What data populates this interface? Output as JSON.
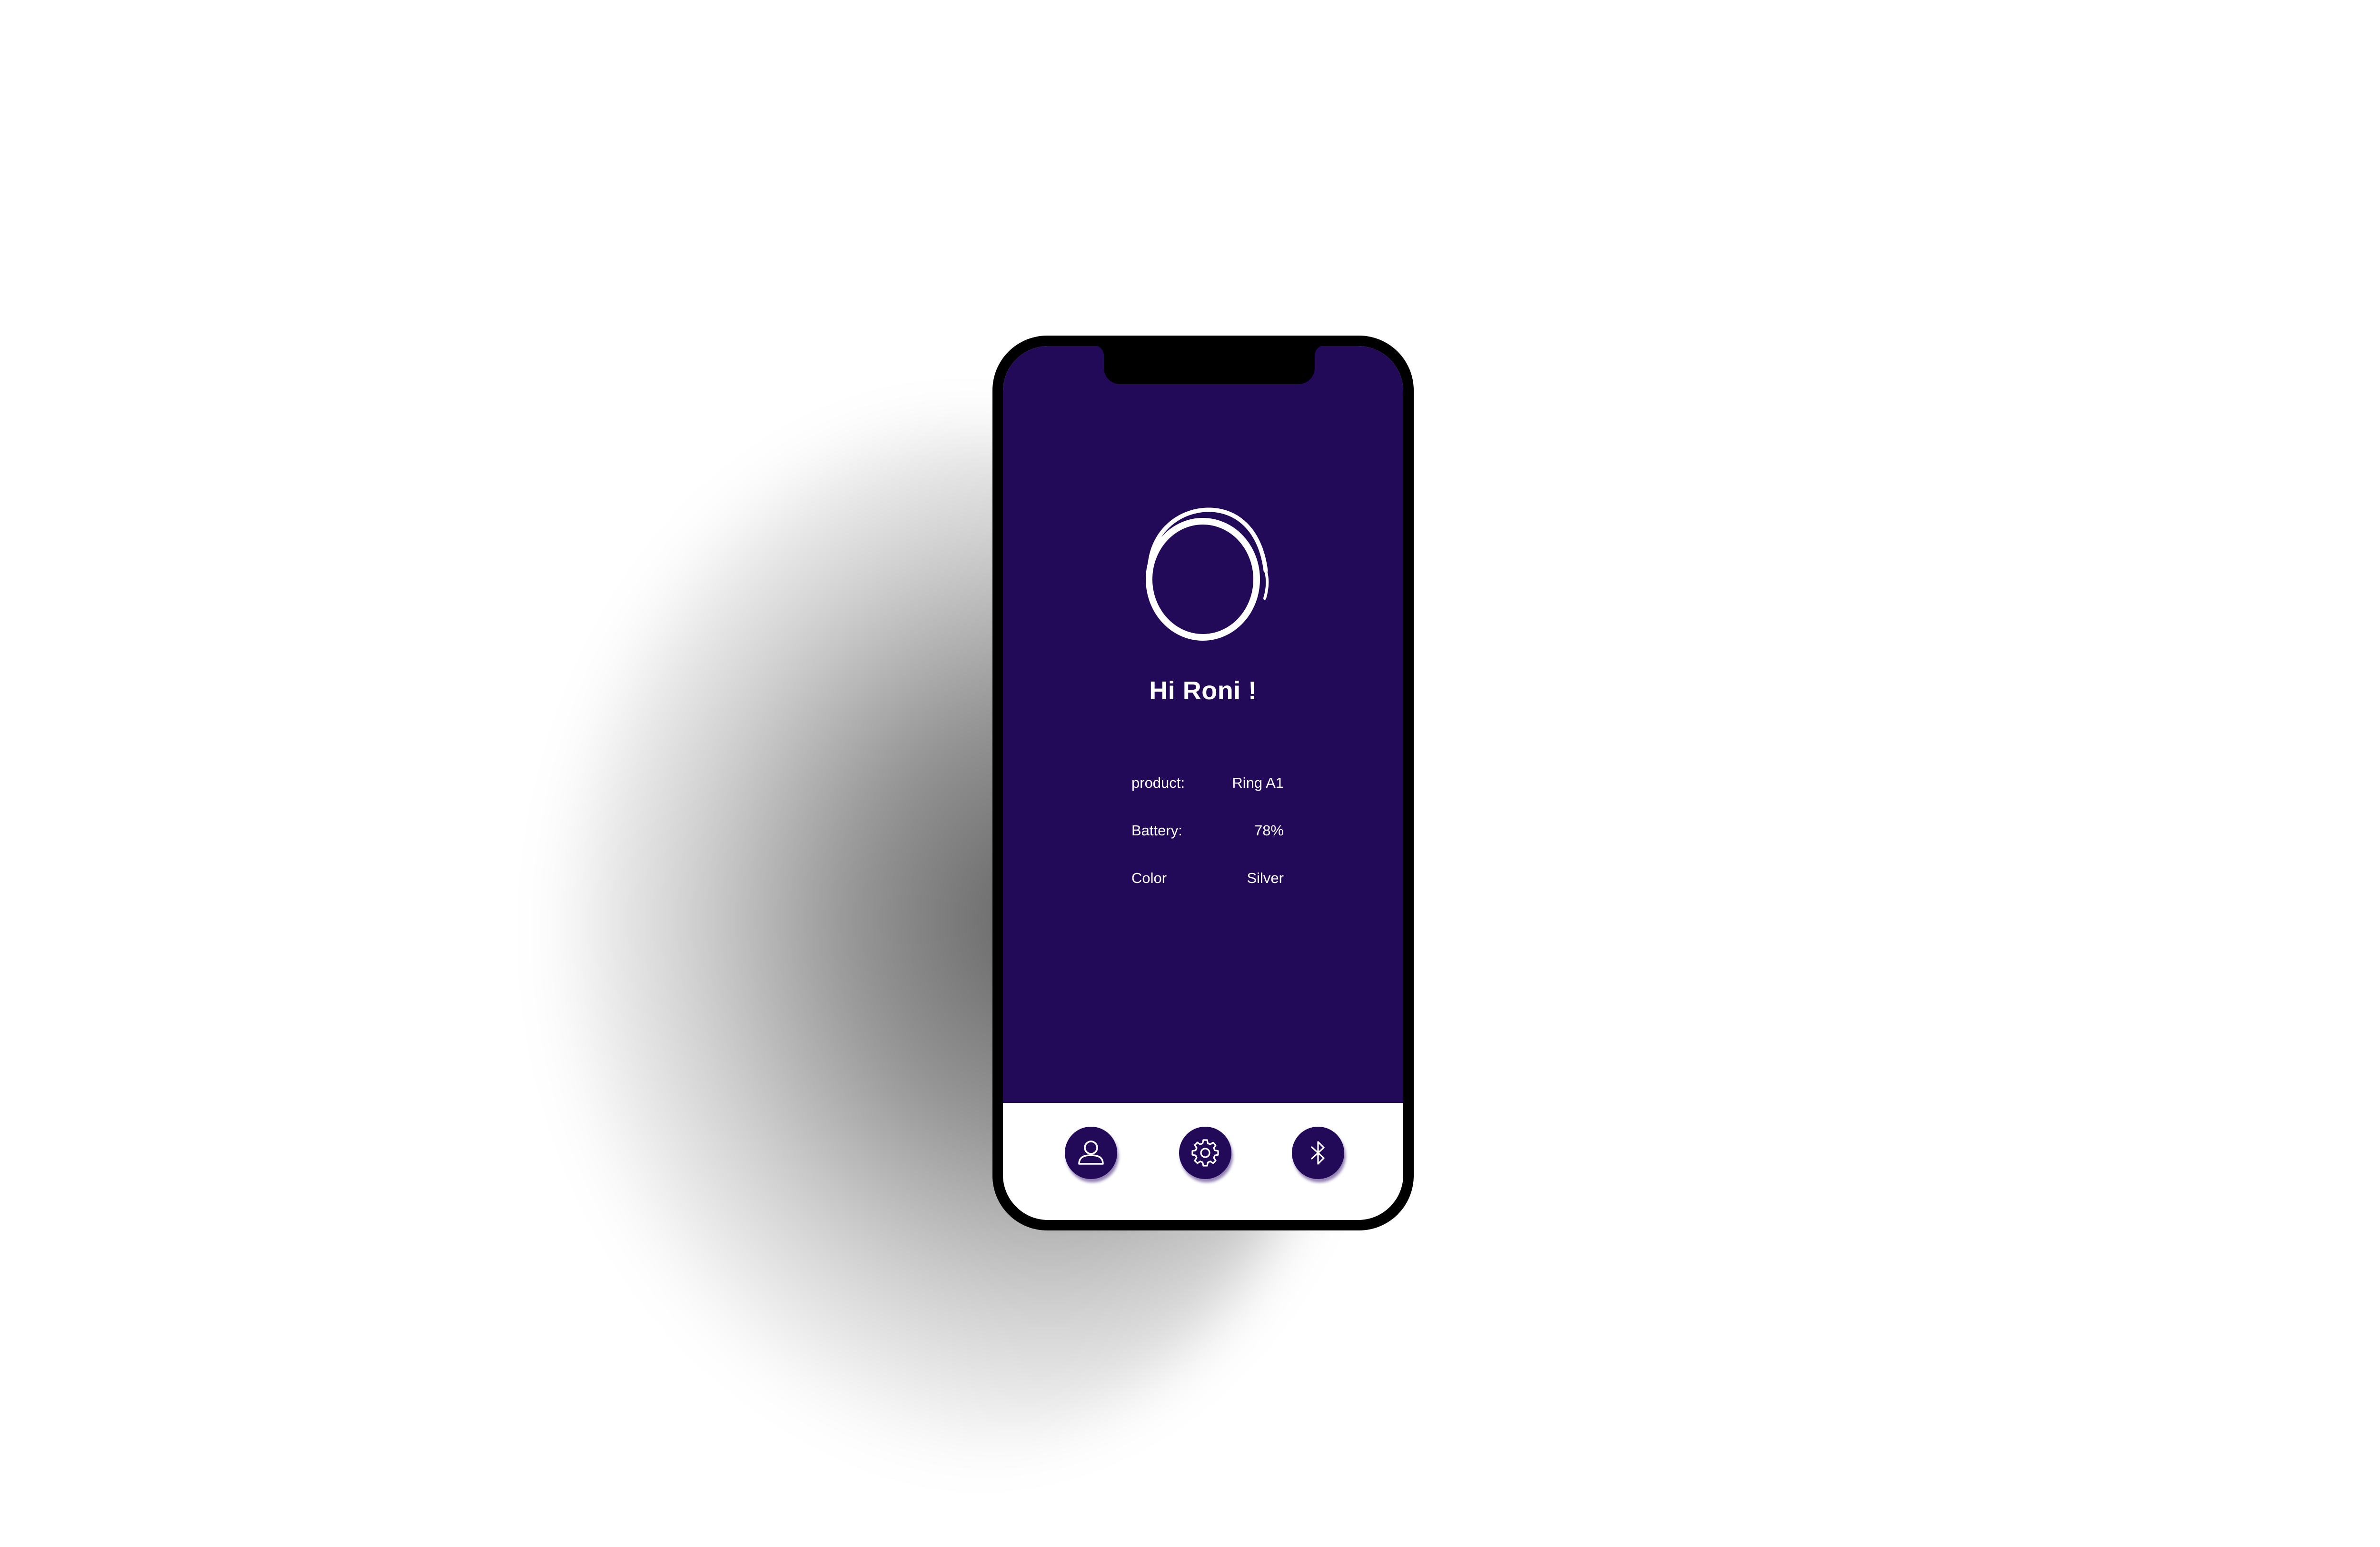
{
  "greeting": "Hi Roni !",
  "device_info": [
    {
      "label": "product:",
      "value": "Ring A1"
    },
    {
      "label": "Battery:",
      "value": "78%"
    },
    {
      "label": "Color",
      "value": "Silver"
    }
  ],
  "nav": {
    "items": [
      {
        "name": "profile",
        "icon": "user-icon"
      },
      {
        "name": "settings",
        "icon": "gear-icon"
      },
      {
        "name": "bluetooth",
        "icon": "bluetooth-icon"
      }
    ]
  },
  "colors": {
    "primary": "#220a58",
    "background": "#ffffff",
    "frame": "#000000",
    "text_on_primary": "#ffffff"
  }
}
